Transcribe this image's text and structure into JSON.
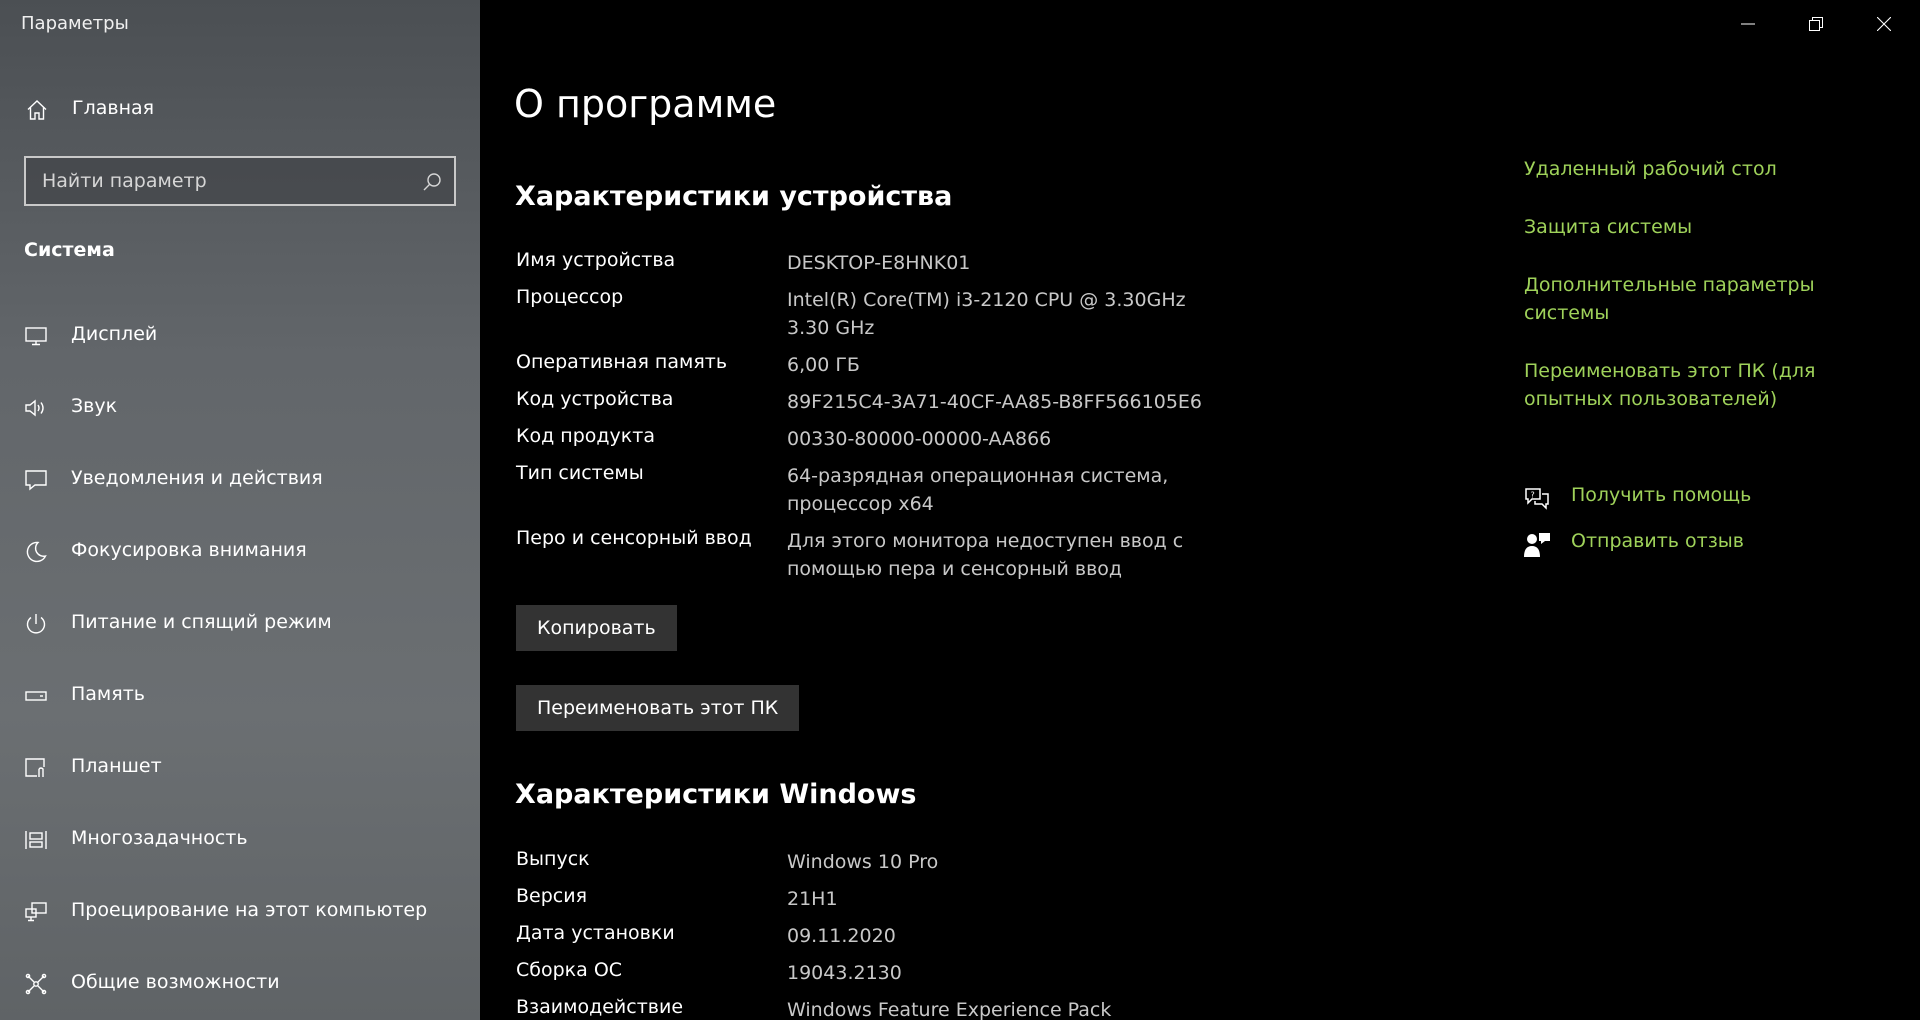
{
  "window": {
    "title": "Параметры"
  },
  "sidebar": {
    "home_label": "Главная",
    "search_placeholder": "Найти параметр",
    "section": "Система",
    "items": [
      {
        "label": "Дисплей",
        "icon": "display-icon"
      },
      {
        "label": "Звук",
        "icon": "speaker-icon"
      },
      {
        "label": "Уведомления и действия",
        "icon": "notification-icon"
      },
      {
        "label": "Фокусировка внимания",
        "icon": "moon-icon"
      },
      {
        "label": "Питание и спящий режим",
        "icon": "power-icon"
      },
      {
        "label": "Память",
        "icon": "storage-icon"
      },
      {
        "label": "Планшет",
        "icon": "tablet-icon"
      },
      {
        "label": "Многозадачность",
        "icon": "multitasking-icon"
      },
      {
        "label": "Проецирование на этот компьютер",
        "icon": "projecting-icon"
      },
      {
        "label": "Общие возможности",
        "icon": "shared-experiences-icon"
      }
    ]
  },
  "main": {
    "title": "О программе",
    "device_heading": "Характеристики устройства",
    "device_specs": [
      {
        "key": "Имя устройства",
        "value": "DESKTOP-E8HNK01"
      },
      {
        "key": "Процессор",
        "value": "Intel(R) Core(TM) i3-2120 CPU @ 3.30GHz 3.30 GHz"
      },
      {
        "key": "Оперативная память",
        "value": "6,00 ГБ"
      },
      {
        "key": "Код устройства",
        "value": "89F215C4-3A71-40CF-AA85-B8FF566105E6"
      },
      {
        "key": "Код продукта",
        "value": "00330-80000-00000-AA866"
      },
      {
        "key": "Тип системы",
        "value": "64-разрядная операционная система, процессор x64"
      },
      {
        "key": "Перо и сенсорный ввод",
        "value": "Для этого монитора недоступен ввод с помощью пера и сенсорный ввод"
      }
    ],
    "copy_button": "Копировать",
    "rename_button": "Переименовать этот ПК",
    "windows_heading": "Характеристики Windows",
    "windows_specs": [
      {
        "key": "Выпуск",
        "value": "Windows 10 Pro"
      },
      {
        "key": "Версия",
        "value": "21H1"
      },
      {
        "key": "Дата установки",
        "value": "09.11.2020"
      },
      {
        "key": "Сборка ОС",
        "value": "19043.2130"
      },
      {
        "key": "Взаимодействие",
        "value": "Windows Feature Experience Pack"
      }
    ]
  },
  "related": {
    "links": [
      "Удаленный рабочий стол",
      "Защита системы",
      "Дополнительные параметры системы",
      "Переименовать этот ПК (для опытных пользователей)"
    ],
    "help": "Получить помощь",
    "feedback": "Отправить отзыв"
  },
  "colors": {
    "accent_link": "#9fd25a",
    "button_bg": "#333333"
  }
}
